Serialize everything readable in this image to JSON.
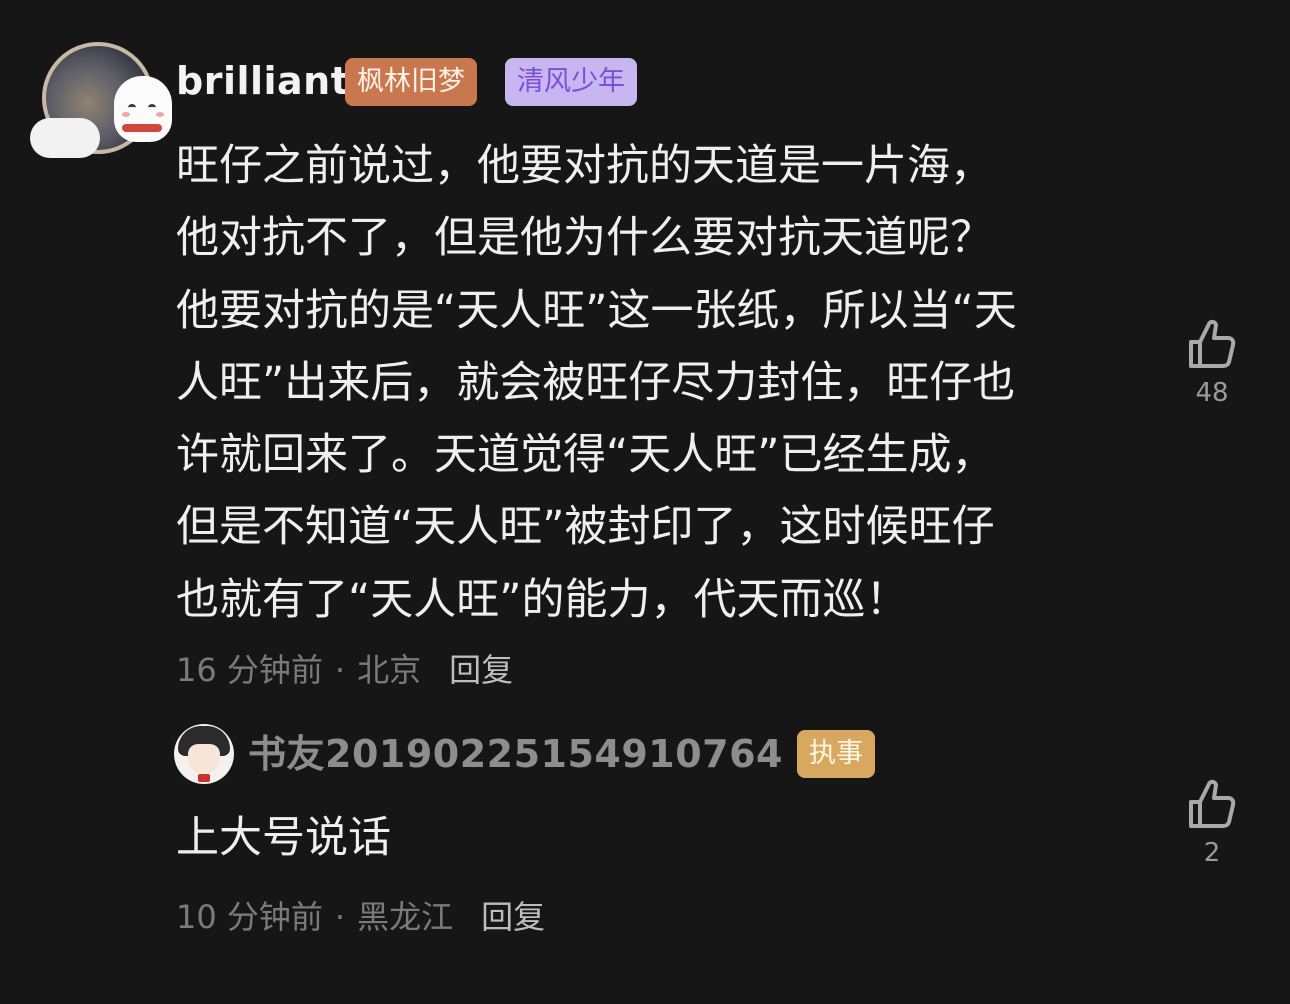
{
  "main_comment": {
    "username": "brilliant",
    "badges": [
      "枫林旧梦",
      "清风少年"
    ],
    "text": "旺仔之前说过，他要对抗的天道是一片海，\n他对抗不了，但是他为什么要对抗天道呢？\n他要对抗的是“天人旺”这一张纸，所以当“天\n人旺”出来后，就会被旺仔尽力封住，旺仔也\n许就回来了。天道觉得“天人旺”已经生成，\n但是不知道“天人旺”被封印了，这时候旺仔\n也就有了“天人旺”的能力，代天而巡！",
    "time": "16 分钟前",
    "separator": "·",
    "location": "北京",
    "reply_label": "回复",
    "likes": "48"
  },
  "reply": {
    "username": "书友20190225154910764",
    "badge": "执事",
    "text": "上大号说话",
    "time": "10 分钟前",
    "separator": "·",
    "location": "黑龙江",
    "reply_label": "回复",
    "likes": "2"
  },
  "colors": {
    "background": "#161616",
    "badge_maple": "#c9774f",
    "badge_wind": "#c7b6f0",
    "badge_exec": "#d8a860"
  },
  "icons": {
    "like": "thumbs-up-icon"
  }
}
